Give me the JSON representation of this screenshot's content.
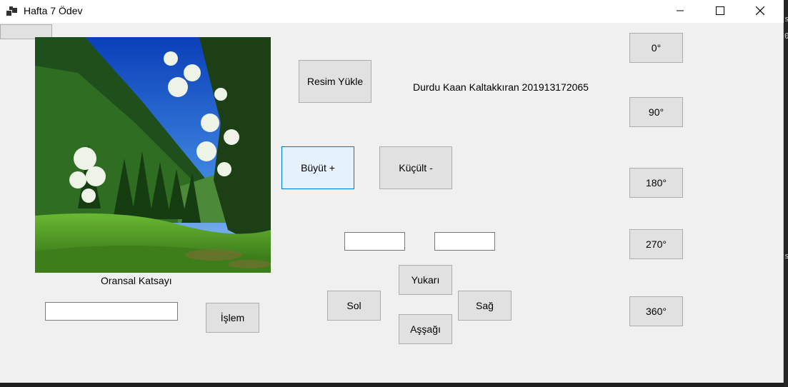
{
  "window": {
    "title": "Hafta 7 Ödev",
    "controls": {
      "minimize": "minimize",
      "maximize": "maximize",
      "close": "close"
    }
  },
  "picture": {
    "description_icon": "landscape-image"
  },
  "labels": {
    "author": "Durdu Kaan Kaltakkıran 201913172065",
    "ratio": "Oransal Katsayı"
  },
  "buttons": {
    "load_image": "Resim Yükle",
    "enlarge": "Büyüt +",
    "shrink": "Küçült -",
    "up": "Yukarı",
    "down": "Aşşağı",
    "left": "Sol",
    "right": "Sağ",
    "process": "İşlem",
    "rot_0": "0°",
    "rot_90": "90°",
    "rot_180": "180°",
    "rot_270": "270°",
    "rot_360": "360°"
  },
  "inputs": {
    "ratio_value": "",
    "x_value": "",
    "y_value": ""
  },
  "colors": {
    "focus_border": "#0078d7",
    "button_bg": "#e1e1e1",
    "window_bg": "#f0f0f0"
  }
}
